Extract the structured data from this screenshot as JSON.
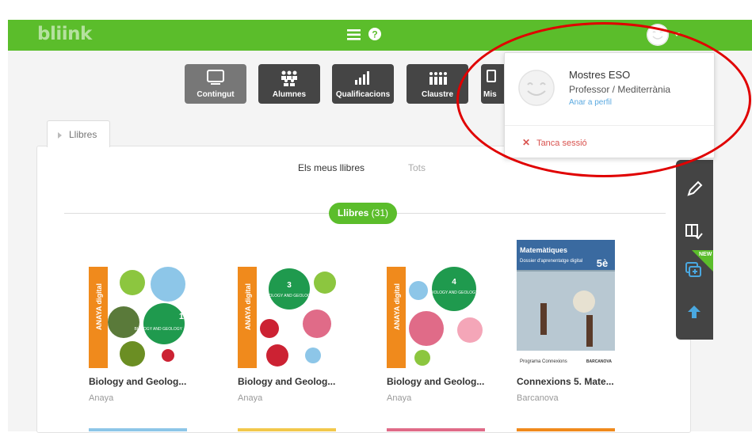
{
  "topbar": {
    "logo": "bliink",
    "menu_icon": "hamburger-icon",
    "help_icon": "question-icon",
    "avatar_icon": "smiley-avatar-icon",
    "brand_color": "#5bbd2b"
  },
  "tiles": [
    {
      "label": "Contingut",
      "icon": "screen-icon"
    },
    {
      "label": "Alumnes",
      "icon": "students-icon"
    },
    {
      "label": "Qualificacions",
      "icon": "bars-icon"
    },
    {
      "label": "Claustre",
      "icon": "staff-icon"
    },
    {
      "label": "Mis",
      "icon": "messages-icon"
    }
  ],
  "tab": {
    "label": "Llibres"
  },
  "subnav": {
    "mine": "Els meus llibres",
    "all": "Tots"
  },
  "filter": {
    "label": "Llibres",
    "count": "(31)"
  },
  "books": [
    {
      "title": "Biology and Geolog...",
      "publisher": "Anaya",
      "cover": {
        "brand": "ANAYA digital",
        "number": "1",
        "subject": "BIOLOGY AND GEOLOGY"
      }
    },
    {
      "title": "Biology and Geolog...",
      "publisher": "Anaya",
      "cover": {
        "brand": "ANAYA digital",
        "number": "3",
        "subject": "BIOLOGY AND GEOLOGY"
      }
    },
    {
      "title": "Biology and Geolog...",
      "publisher": "Anaya",
      "cover": {
        "brand": "ANAYA digital",
        "number": "4",
        "subject": "BIOLOGY AND GEOLOGY"
      }
    },
    {
      "title": "Connexions 5. Mate...",
      "publisher": "Barcanova",
      "cover": {
        "heading": "Matemàtiques",
        "sub": "Dossier d'aprenentatge digital",
        "grade": "5è",
        "footer": "Programa Connexions",
        "brand": "BARCANOVA"
      }
    }
  ],
  "dropdown": {
    "name": "Mostres ESO",
    "role": "Professor / Mediterrània",
    "profile_link": "Anar a perfil",
    "logout": "Tanca sessió"
  },
  "sidetools": {
    "icons": [
      "pencil-icon",
      "book-check-icon",
      "cards-add-icon",
      "arrow-up-icon"
    ],
    "badge": "NEW"
  }
}
